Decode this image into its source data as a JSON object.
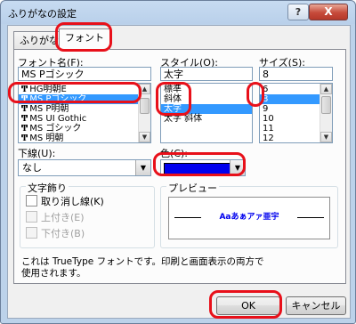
{
  "window": {
    "title": "ふりがなの設定",
    "help_label": "?",
    "close_label": "X"
  },
  "tabs": [
    {
      "label": "ふりがな"
    },
    {
      "label": "フォント"
    }
  ],
  "font_name": {
    "label": "フォント名(F):",
    "value": "MS Pゴシック",
    "items": [
      {
        "label": "HG明朝E",
        "truetype": true,
        "selected": false
      },
      {
        "label": "MS Pゴシック",
        "truetype": true,
        "selected": true
      },
      {
        "label": "MS P明朝",
        "truetype": true,
        "selected": false
      },
      {
        "label": "MS UI Gothic",
        "truetype": true,
        "selected": false
      },
      {
        "label": "MS ゴシック",
        "truetype": true,
        "selected": false
      },
      {
        "label": "MS 明朝",
        "truetype": true,
        "selected": false
      }
    ]
  },
  "style": {
    "label": "スタイル(O):",
    "value": "太字",
    "items": [
      {
        "label": "標準",
        "selected": false
      },
      {
        "label": "斜体",
        "selected": false
      },
      {
        "label": "太字",
        "selected": true
      },
      {
        "label": "太字 斜体",
        "selected": false
      }
    ]
  },
  "size": {
    "label": "サイズ(S):",
    "value": "8",
    "items": [
      {
        "label": "6",
        "selected": false
      },
      {
        "label": "8",
        "selected": true
      },
      {
        "label": "9",
        "selected": false
      },
      {
        "label": "10",
        "selected": false
      },
      {
        "label": "11",
        "selected": false
      },
      {
        "label": "12",
        "selected": false
      }
    ]
  },
  "underline": {
    "label": "下線(U):",
    "value": "なし"
  },
  "color": {
    "label": "色(C):",
    "swatch": "#0000ee"
  },
  "effects": {
    "title": "文字飾り",
    "strike_label": "取り消し線(K)",
    "superscript_label": "上付き(E)",
    "subscript_label": "下付き(B)"
  },
  "preview": {
    "title": "プレビュー",
    "sample": "Aaあぁアァ亜宇",
    "sample_color": "#0000ee"
  },
  "info_text": "これは TrueType フォントです。印刷と画面表示の両方で使用されます。",
  "buttons": {
    "ok": "OK",
    "cancel": "キャンセル"
  },
  "highlight_color": "#e8101a"
}
